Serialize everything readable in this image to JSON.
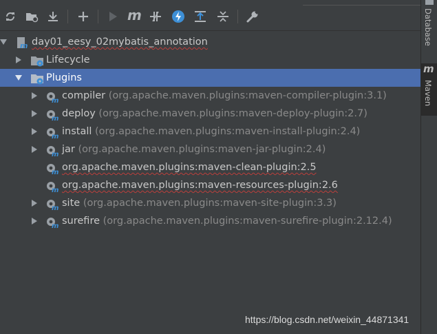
{
  "toolbar": {
    "buttons": [
      {
        "icon": "reimport-icon"
      },
      {
        "icon": "generate-sources-icon"
      },
      {
        "icon": "download-icon"
      },
      {
        "icon": "add-project-icon"
      },
      {
        "icon": "run-icon"
      },
      {
        "icon": "maven-goal-icon",
        "glyph": "m"
      },
      {
        "icon": "toggle-offline-icon"
      },
      {
        "icon": "skip-tests-icon"
      },
      {
        "icon": "show-dependencies-icon"
      },
      {
        "icon": "collapse-all-icon"
      },
      {
        "icon": "settings-wrench-icon"
      }
    ]
  },
  "tree": {
    "project": {
      "name": "day01_eesy_02mybatis_annotation"
    },
    "lifecycle": {
      "name": "Lifecycle"
    },
    "plugins": {
      "name": "Plugins",
      "items": [
        {
          "name": "compiler",
          "coords": "(org.apache.maven.plugins:maven-compiler-plugin:3.1)",
          "expandable": true
        },
        {
          "name": "deploy",
          "coords": "(org.apache.maven.plugins:maven-deploy-plugin:2.7)",
          "expandable": true
        },
        {
          "name": "install",
          "coords": "(org.apache.maven.plugins:maven-install-plugin:2.4)",
          "expandable": true
        },
        {
          "name": "jar",
          "coords": "(org.apache.maven.plugins:maven-jar-plugin:2.4)",
          "expandable": true
        },
        {
          "name": "org.apache.maven.plugins:maven-clean-plugin:2.5",
          "coords": "",
          "expandable": false,
          "error": true
        },
        {
          "name": "org.apache.maven.plugins:maven-resources-plugin:2.6",
          "coords": "",
          "expandable": false,
          "error": true
        },
        {
          "name": "site",
          "coords": "(org.apache.maven.plugins:maven-site-plugin:3.3)",
          "expandable": true
        },
        {
          "name": "surefire",
          "coords": "(org.apache.maven.plugins:maven-surefire-plugin:2.12.4)",
          "expandable": true
        }
      ]
    }
  },
  "sidebar": {
    "database_label": "Database",
    "maven_label": "Maven",
    "maven_glyph": "m"
  },
  "watermark": "https://blog.csdn.net/weixin_44871341",
  "colors": {
    "background": "#3c3f41",
    "selection": "#4b6eaf",
    "error_underline": "#bc3f3c",
    "maven_blue": "#3d8fd6"
  }
}
